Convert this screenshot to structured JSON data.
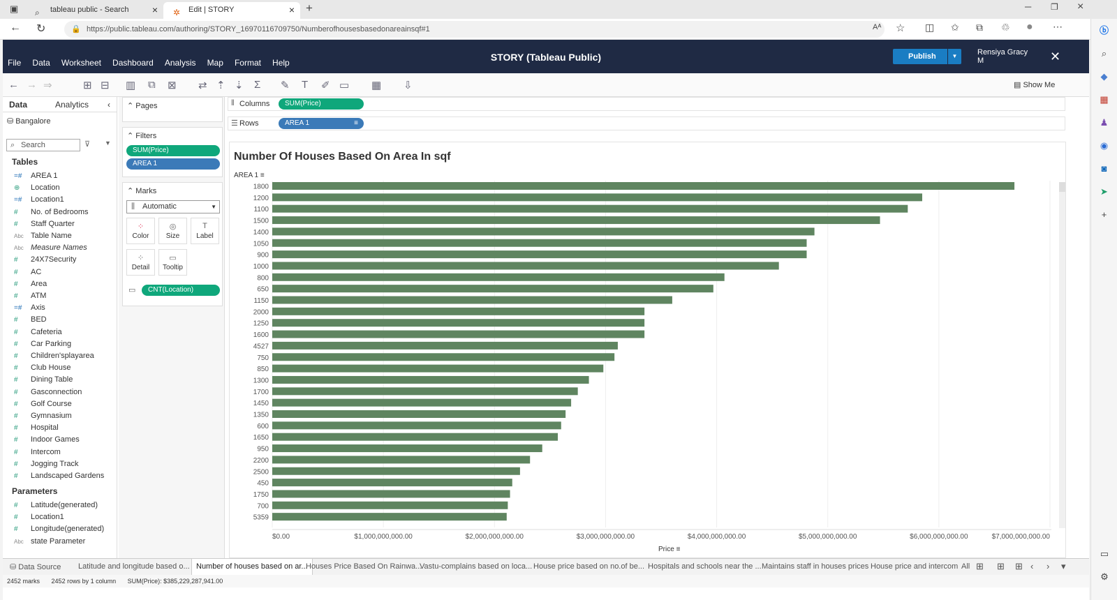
{
  "browser": {
    "tabs": [
      {
        "label": "tableau public - Search"
      },
      {
        "label": "Edit | STORY"
      }
    ],
    "url": "https://public.tableau.com/authoring/STORY_16970116709750/Numberofhousesbasedonareainsqf#1"
  },
  "app": {
    "menu": [
      "File",
      "Data",
      "Worksheet",
      "Dashboard",
      "Analysis",
      "Map",
      "Format",
      "Help"
    ],
    "title": "STORY (Tableau Public)",
    "publish_label": "Publish",
    "user_line1": "Rensiya Gracy",
    "user_line2": "M",
    "show_me": "Show Me"
  },
  "data_pane": {
    "tab_data": "Data",
    "tab_analytics": "Analytics",
    "source": "Bangalore",
    "search_placeholder": "Search",
    "tables_header": "Tables",
    "fields": [
      {
        "name": "AREA 1",
        "kind": "dim"
      },
      {
        "name": "Location",
        "kind": "geo"
      },
      {
        "name": "Location1",
        "kind": "dim"
      },
      {
        "name": "No. of Bedrooms",
        "kind": "num"
      },
      {
        "name": "Staff Quarter",
        "kind": "num"
      },
      {
        "name": "Table Name",
        "kind": "abc"
      },
      {
        "name": "Measure Names",
        "kind": "abc"
      },
      {
        "name": "24X7Security",
        "kind": "num"
      },
      {
        "name": "AC",
        "kind": "num"
      },
      {
        "name": "Area",
        "kind": "num"
      },
      {
        "name": "ATM",
        "kind": "num"
      },
      {
        "name": "Axis",
        "kind": "dim"
      },
      {
        "name": "BED",
        "kind": "num"
      },
      {
        "name": "Cafeteria",
        "kind": "num"
      },
      {
        "name": "Car Parking",
        "kind": "num"
      },
      {
        "name": "Children'splayarea",
        "kind": "num"
      },
      {
        "name": "Club House",
        "kind": "num"
      },
      {
        "name": "Dining Table",
        "kind": "num"
      },
      {
        "name": "Gasconnection",
        "kind": "num"
      },
      {
        "name": "Golf Course",
        "kind": "num"
      },
      {
        "name": "Gymnasium",
        "kind": "num"
      },
      {
        "name": "Hospital",
        "kind": "num"
      },
      {
        "name": "Indoor Games",
        "kind": "num"
      },
      {
        "name": "Intercom",
        "kind": "num"
      },
      {
        "name": "Jogging Track",
        "kind": "num"
      },
      {
        "name": "Landscaped Gardens",
        "kind": "num"
      }
    ],
    "parameters_header": "Parameters",
    "parameters": [
      {
        "name": "Latitude(generated)",
        "kind": "num"
      },
      {
        "name": "Location1",
        "kind": "num"
      },
      {
        "name": "Longitude(generated)",
        "kind": "num"
      },
      {
        "name": "state Parameter",
        "kind": "abc"
      }
    ]
  },
  "cards": {
    "pages": "Pages",
    "filters": "Filters",
    "filter_pills": [
      "SUM(Price)",
      "AREA 1"
    ],
    "marks": "Marks",
    "mark_type": "Automatic",
    "mark_buttons": [
      "Color",
      "Size",
      "Label",
      "Detail",
      "Tooltip"
    ],
    "marks_pill": "CNT(Location)"
  },
  "shelves": {
    "columns_label": "Columns",
    "columns_pill": "SUM(Price)",
    "rows_label": "Rows",
    "rows_pill": "AREA 1"
  },
  "chart_data": {
    "type": "bar",
    "title": "Number Of Houses Based On Area In sqf",
    "ylabel": "AREA 1",
    "xlabel": "Price",
    "categories": [
      "1800",
      "1200",
      "1100",
      "1500",
      "1400",
      "1050",
      "900",
      "1000",
      "800",
      "650",
      "1150",
      "2000",
      "1250",
      "1600",
      "4527",
      "750",
      "850",
      "1300",
      "1700",
      "1450",
      "1350",
      "600",
      "1650",
      "950",
      "2200",
      "2500",
      "450",
      "1750",
      "700",
      "5359"
    ],
    "values": [
      6680000000.0,
      5850000000.0,
      5720000000.0,
      5470000000.0,
      4880000000.0,
      4810000000.0,
      4810000000.0,
      4560000000.0,
      4070000000.0,
      3970000000.0,
      3600000000.0,
      3350000000.0,
      3350000000.0,
      3350000000.0,
      3110000000.0,
      3080000000.0,
      2980000000.0,
      2850000000.0,
      2750000000.0,
      2690000000.0,
      2640000000.0,
      2600000000.0,
      2570000000.0,
      2430000000.0,
      2320000000.0,
      2230000000.0,
      2160000000.0,
      2140000000.0,
      2120000000.0,
      2110000000.0
    ],
    "x_ticks": [
      "$0.00",
      "$1,000,000,000.00",
      "$2,000,000,000.00",
      "$3,000,000,000.00",
      "$4,000,000,000.00",
      "$5,000,000,000.00",
      "$6,000,000,000.00",
      "$7,000,000,000.00"
    ],
    "xlim": [
      0,
      7000000000
    ],
    "bar_color": "#5f8560",
    "grid": true,
    "legend": "none"
  },
  "sheet_tabs": [
    "Data Source",
    "Latitude and longitude based o...",
    "Number of houses based on ar...",
    "Houses Price Based On Rainwa...",
    "Vastu-complains based on loca...",
    "House price based on no.of be...",
    "Hospitals and schools near the ...",
    "Maintains staff in houses prices",
    "House price and intercom",
    "All"
  ],
  "status": {
    "marks": "2452 marks",
    "rows": "2452 rows by 1 column",
    "sum": "SUM(Price): $385,229,287,941.00"
  }
}
